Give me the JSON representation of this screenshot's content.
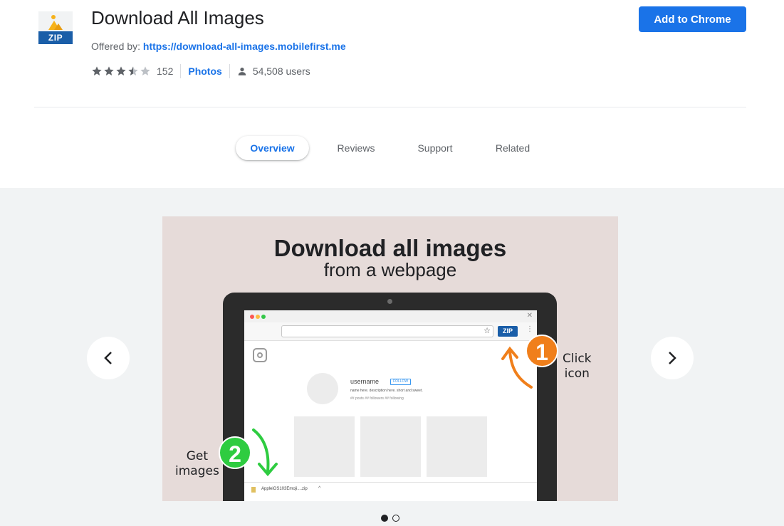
{
  "header": {
    "icon_label": "ZIP",
    "title": "Download All Images",
    "offered_label": "Offered by:",
    "offered_link": "https://download-all-images.mobilefirst.me",
    "rating_count": "152",
    "rating_value": 3.5,
    "photos_label": "Photos",
    "users": "54,508 users",
    "add_button": "Add to Chrome"
  },
  "tabs": [
    {
      "label": "Overview",
      "active": true
    },
    {
      "label": "Reviews",
      "active": false
    },
    {
      "label": "Support",
      "active": false
    },
    {
      "label": "Related",
      "active": false
    }
  ],
  "slide": {
    "headline": "Download all images",
    "subheadline": "from a webpage",
    "zip_badge": "ZIP",
    "step1": "1",
    "step1_text_line1": "Click",
    "step1_text_line2": "icon",
    "step2": "2",
    "step2_text_line1": "Get",
    "step2_text_line2": "images",
    "profile_username": "username",
    "profile_follow": "FOLLOW",
    "profile_bio": "name here. description here. short and sweet.",
    "profile_stats": "## posts   ## followers   ## following",
    "download_file": "AppleiOS103Emoji....zip"
  },
  "colors": {
    "accent": "#1a73e8",
    "orange": "#f07f1b",
    "green": "#2ecc40"
  },
  "pager": {
    "total": 2,
    "current": 1
  }
}
